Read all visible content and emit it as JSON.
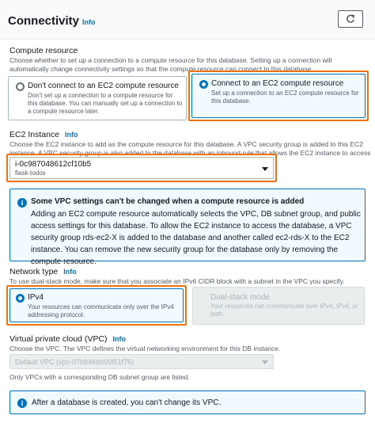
{
  "header": {
    "title": "Connectivity",
    "info": "Info"
  },
  "compute": {
    "label": "Compute resource",
    "description": "Choose whether to set up a connection to a compute resource for this database. Setting up a connection will automatically change connectivity settings so that the compute resource can connect to this database.",
    "option_none": {
      "title": "Don't connect to an EC2 compute resource",
      "description": "Don't set up a connection to a compute resource for this database. You can manually set up a connection to a compute resource later."
    },
    "option_connect": {
      "title": "Connect to an EC2 compute resource",
      "description": "Set up a connection to an EC2 compute resource for this database."
    }
  },
  "ec2": {
    "label": "EC2 Instance",
    "info": "Info",
    "description": "Choose the EC2 instance to add as the compute resource for this database. A VPC security group is added to this EC2 instance. A VPC security group is also added to the database with an inbound rule that allows the EC2 instance to access the database.",
    "selected_id": "i-0c987048612cf10b5",
    "selected_name": "flask-todos"
  },
  "vpc_alert": {
    "title": "Some VPC settings can't be changed when a compute resource is added",
    "body": "Adding an EC2 compute resource automatically selects the VPC, DB subnet group, and public access settings for this database. To allow the EC2 instance to access the database, a VPC security group rds-ec2-X is added to the database and another called ec2-rds-X to the EC2 instance. You can remove the new security group for the database only by removing the compute resource."
  },
  "network": {
    "label": "Network type",
    "info": "Info",
    "description": "To use dual-stack mode, make sure that you associate an IPv6 CIDR block with a subnet in the VPC you specify.",
    "ipv4": {
      "title": "IPv4",
      "description": "Your resources can communicate only over the IPv4 addressing protocol."
    },
    "dual": {
      "title": "Dual-stack mode",
      "description": "Your resources can communicate over IPv4, IPv6, or both."
    }
  },
  "vpc": {
    "label": "Virtual private cloud (VPC)",
    "info": "Info",
    "description": "Choose the VPC. The VPC defines the virtual networking environment for this DB instance.",
    "selected": "Default VPC (vpc-07b846bb09f51f76)",
    "hint": "Only VPCs with a corresponding DB subnet group are listed."
  },
  "final_alert": {
    "text": "After a database is created, you can't change its VPC."
  },
  "colors": {
    "accent": "#0073bb",
    "highlight": "#ec7211"
  },
  "icons": {
    "refresh": "refresh-icon",
    "info": "info-circle-icon",
    "caret": "caret-down-icon"
  }
}
